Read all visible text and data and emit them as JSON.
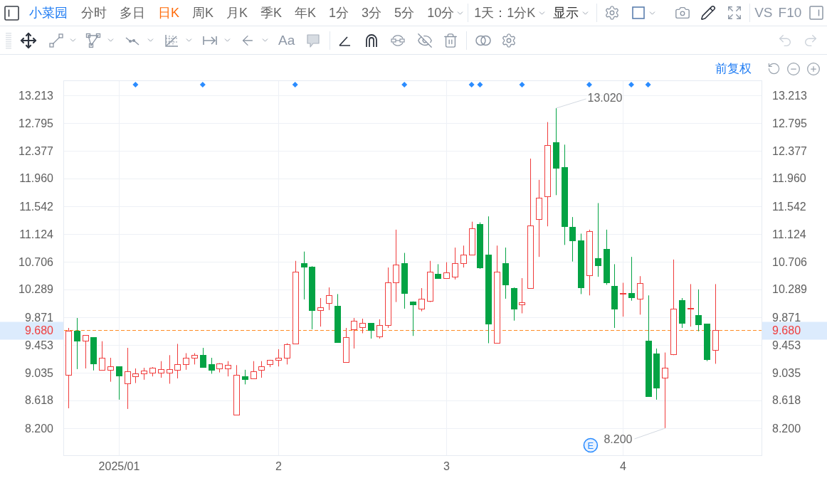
{
  "toolbar": {
    "brand": "小菜园",
    "tabs": [
      {
        "label": "分时",
        "selected": false,
        "menu": false
      },
      {
        "label": "多日",
        "selected": false,
        "menu": false
      },
      {
        "label": "日K",
        "selected": true,
        "menu": false
      },
      {
        "label": "周K",
        "selected": false,
        "menu": false
      },
      {
        "label": "月K",
        "selected": false,
        "menu": false
      },
      {
        "label": "季K",
        "selected": false,
        "menu": false
      },
      {
        "label": "年K",
        "selected": false,
        "menu": false
      },
      {
        "label": "1分",
        "selected": false,
        "menu": false
      },
      {
        "label": "3分",
        "selected": false,
        "menu": false
      },
      {
        "label": "5分",
        "selected": false,
        "menu": false
      },
      {
        "label": "10分",
        "selected": false,
        "menu": true
      }
    ],
    "range_menu": "1天：1分K",
    "display_menu": "显示",
    "compare": "VS",
    "f10": "F10"
  },
  "drawing_toolbar": {
    "text_tool": "Aa",
    "undo": {
      "disabled": true
    },
    "redo": {
      "disabled": true
    }
  },
  "chart": {
    "adjust_mode": "前复权",
    "right_axis_labels": [
      "13.213",
      "12.795",
      "12.377",
      "11.960",
      "11.542",
      "11.124",
      "10.706",
      "10.289",
      "9.871",
      "9.453",
      "9.035",
      "8.618",
      "8.200"
    ],
    "right_price_label": "9.680",
    "event_marks": [
      false,
      false,
      false,
      false,
      false,
      false,
      false,
      false,
      true,
      false,
      false,
      false,
      false,
      false,
      false,
      false,
      true,
      false,
      false,
      false,
      false,
      false,
      false,
      false,
      false,
      false,
      false,
      true,
      false,
      false,
      false,
      false,
      false,
      false,
      false,
      false,
      false,
      false,
      false,
      false,
      true,
      false,
      false,
      false,
      false,
      false,
      false,
      false,
      true,
      true,
      false,
      false,
      false,
      false,
      true,
      false,
      false,
      false,
      false,
      false,
      false,
      false,
      true,
      false,
      false,
      false,
      false,
      true,
      false,
      true,
      false,
      false,
      false,
      false,
      false,
      false,
      false,
      false
    ],
    "chart_data": {
      "type": "candlestick",
      "grid": true,
      "categories": [
        null,
        null,
        null,
        null,
        null,
        null,
        "2025/01",
        null,
        null,
        null,
        null,
        null,
        null,
        null,
        null,
        null,
        null,
        null,
        null,
        null,
        null,
        null,
        null,
        null,
        null,
        "2",
        null,
        null,
        null,
        null,
        null,
        null,
        null,
        null,
        null,
        null,
        null,
        null,
        null,
        null,
        null,
        null,
        null,
        null,
        null,
        "3",
        null,
        null,
        null,
        null,
        null,
        null,
        null,
        null,
        null,
        null,
        null,
        null,
        null,
        null,
        null,
        null,
        null,
        null,
        null,
        null,
        "4",
        null,
        null,
        null,
        null,
        null,
        null,
        null,
        null,
        null,
        null,
        null,
        null,
        null,
        null,
        null,
        null
      ],
      "ylim": [
        7.793,
        13.438
      ],
      "yticks": [
        {
          "value": 13.213,
          "label": "13.213"
        },
        {
          "value": 12.795,
          "label": "12.795"
        },
        {
          "value": 12.377,
          "label": "12.377"
        },
        {
          "value": 11.96,
          "label": "11.960"
        },
        {
          "value": 11.542,
          "label": "11.542"
        },
        {
          "value": 11.124,
          "label": "11.124"
        },
        {
          "value": 10.706,
          "label": "10.706"
        },
        {
          "value": 10.289,
          "label": "10.289"
        },
        {
          "value": 9.871,
          "label": "9.871"
        },
        {
          "value": 9.453,
          "label": "9.453"
        },
        {
          "value": 9.035,
          "label": "9.035"
        },
        {
          "value": 8.618,
          "label": "8.618"
        },
        {
          "value": 8.2,
          "label": "8.200"
        }
      ],
      "ohlc": [
        [
          9.0,
          9.71,
          8.5,
          9.67
        ],
        [
          9.67,
          9.86,
          9.09,
          9.52
        ],
        [
          9.52,
          9.6,
          9.1,
          9.6
        ],
        [
          9.57,
          9.57,
          9.07,
          9.18
        ],
        [
          9.08,
          9.51,
          9.08,
          9.26
        ],
        [
          9.08,
          9.26,
          8.9,
          9.13
        ],
        [
          9.13,
          9.13,
          8.63,
          8.99
        ],
        [
          8.88,
          9.41,
          8.49,
          9.06
        ],
        [
          8.98,
          9.1,
          8.88,
          9.03
        ],
        [
          9.03,
          9.11,
          8.93,
          9.07
        ],
        [
          9.04,
          9.12,
          8.98,
          9.11
        ],
        [
          9.04,
          9.21,
          8.96,
          9.09
        ],
        [
          9.04,
          9.3,
          8.87,
          9.09
        ],
        [
          9.08,
          9.47,
          8.95,
          9.16
        ],
        [
          9.16,
          9.33,
          9.08,
          9.26
        ],
        [
          9.26,
          9.33,
          9.16,
          9.3
        ],
        [
          9.3,
          9.41,
          9.11,
          9.12
        ],
        [
          9.16,
          9.26,
          9.02,
          9.08
        ],
        [
          9.1,
          9.18,
          9.04,
          9.17
        ],
        [
          9.1,
          9.21,
          8.98,
          9.15
        ],
        [
          8.4,
          9.15,
          8.4,
          9.0
        ],
        [
          8.98,
          9.08,
          8.86,
          8.94
        ],
        [
          8.95,
          9.21,
          8.95,
          9.06
        ],
        [
          9.08,
          9.21,
          8.96,
          9.13
        ],
        [
          9.16,
          9.23,
          9.12,
          9.23
        ],
        [
          9.23,
          9.39,
          9.13,
          9.26
        ],
        [
          9.26,
          9.48,
          9.16,
          9.46
        ],
        [
          9.48,
          10.72,
          9.48,
          10.56
        ],
        [
          10.68,
          10.86,
          10.14,
          10.63
        ],
        [
          10.63,
          10.64,
          9.69,
          9.98
        ],
        [
          9.98,
          10.16,
          9.73,
          10.02
        ],
        [
          10.08,
          10.32,
          9.98,
          10.2
        ],
        [
          10.04,
          10.22,
          9.5,
          9.5
        ],
        [
          9.2,
          9.71,
          9.19,
          9.57
        ],
        [
          9.69,
          9.86,
          9.4,
          9.82
        ],
        [
          9.72,
          9.85,
          9.63,
          9.78
        ],
        [
          9.78,
          9.78,
          9.55,
          9.68
        ],
        [
          9.58,
          9.84,
          9.55,
          9.75
        ],
        [
          9.75,
          10.62,
          9.71,
          10.4
        ],
        [
          10.4,
          11.19,
          10.1,
          10.66
        ],
        [
          10.68,
          10.84,
          10.0,
          10.24
        ],
        [
          10.11,
          10.11,
          9.59,
          10.06
        ],
        [
          10.0,
          10.31,
          9.96,
          10.15
        ],
        [
          10.12,
          10.72,
          10.1,
          10.56
        ],
        [
          10.52,
          10.67,
          10.45,
          10.46
        ],
        [
          10.46,
          10.7,
          10.46,
          10.55
        ],
        [
          10.48,
          10.92,
          10.44,
          10.69
        ],
        [
          10.69,
          10.95,
          10.62,
          10.81
        ],
        [
          10.81,
          11.31,
          10.81,
          11.21
        ],
        [
          11.27,
          11.3,
          10.6,
          10.62
        ],
        [
          10.81,
          11.39,
          9.48,
          9.77
        ],
        [
          9.49,
          10.95,
          9.49,
          10.56
        ],
        [
          10.69,
          10.92,
          10.15,
          10.36
        ],
        [
          10.31,
          10.32,
          9.82,
          10.0
        ],
        [
          10.06,
          10.46,
          9.93,
          10.1
        ],
        [
          10.31,
          12.26,
          10.31,
          11.25
        ],
        [
          11.35,
          11.94,
          10.78,
          11.67
        ],
        [
          11.69,
          12.81,
          11.24,
          12.46
        ],
        [
          12.51,
          13.02,
          11.71,
          12.12
        ],
        [
          12.13,
          12.47,
          10.96,
          11.24
        ],
        [
          11.23,
          11.38,
          10.71,
          11.03
        ],
        [
          11.03,
          11.13,
          10.22,
          10.32
        ],
        [
          10.5,
          11.19,
          10.2,
          11.17
        ],
        [
          10.76,
          11.59,
          10.48,
          10.65
        ],
        [
          10.9,
          11.19,
          10.36,
          10.4
        ],
        [
          10.34,
          10.67,
          9.71,
          10.0
        ],
        [
          10.23,
          10.39,
          9.88,
          10.24
        ],
        [
          10.23,
          10.78,
          10.12,
          10.17
        ],
        [
          10.15,
          10.49,
          9.91,
          10.39
        ],
        [
          9.52,
          10.2,
          8.68,
          8.68
        ],
        [
          9.33,
          9.4,
          8.63,
          8.81
        ],
        [
          8.96,
          9.34,
          8.2,
          9.11
        ],
        [
          9.31,
          10.74,
          9.3,
          10.0
        ],
        [
          10.13,
          10.16,
          9.71,
          9.79
        ],
        [
          10.0,
          10.37,
          9.73,
          10.01
        ],
        [
          9.9,
          10.29,
          9.66,
          9.76
        ],
        [
          9.77,
          9.77,
          9.21,
          9.24
        ],
        [
          9.38,
          10.37,
          9.17,
          9.68
        ],
        null,
        null,
        null,
        null,
        null
      ],
      "ref_lines": [
        {
          "axis": "y",
          "value": 9.68,
          "label": "9.680"
        }
      ],
      "annotations": [
        "13.020",
        "8.200",
        "E"
      ]
    }
  }
}
